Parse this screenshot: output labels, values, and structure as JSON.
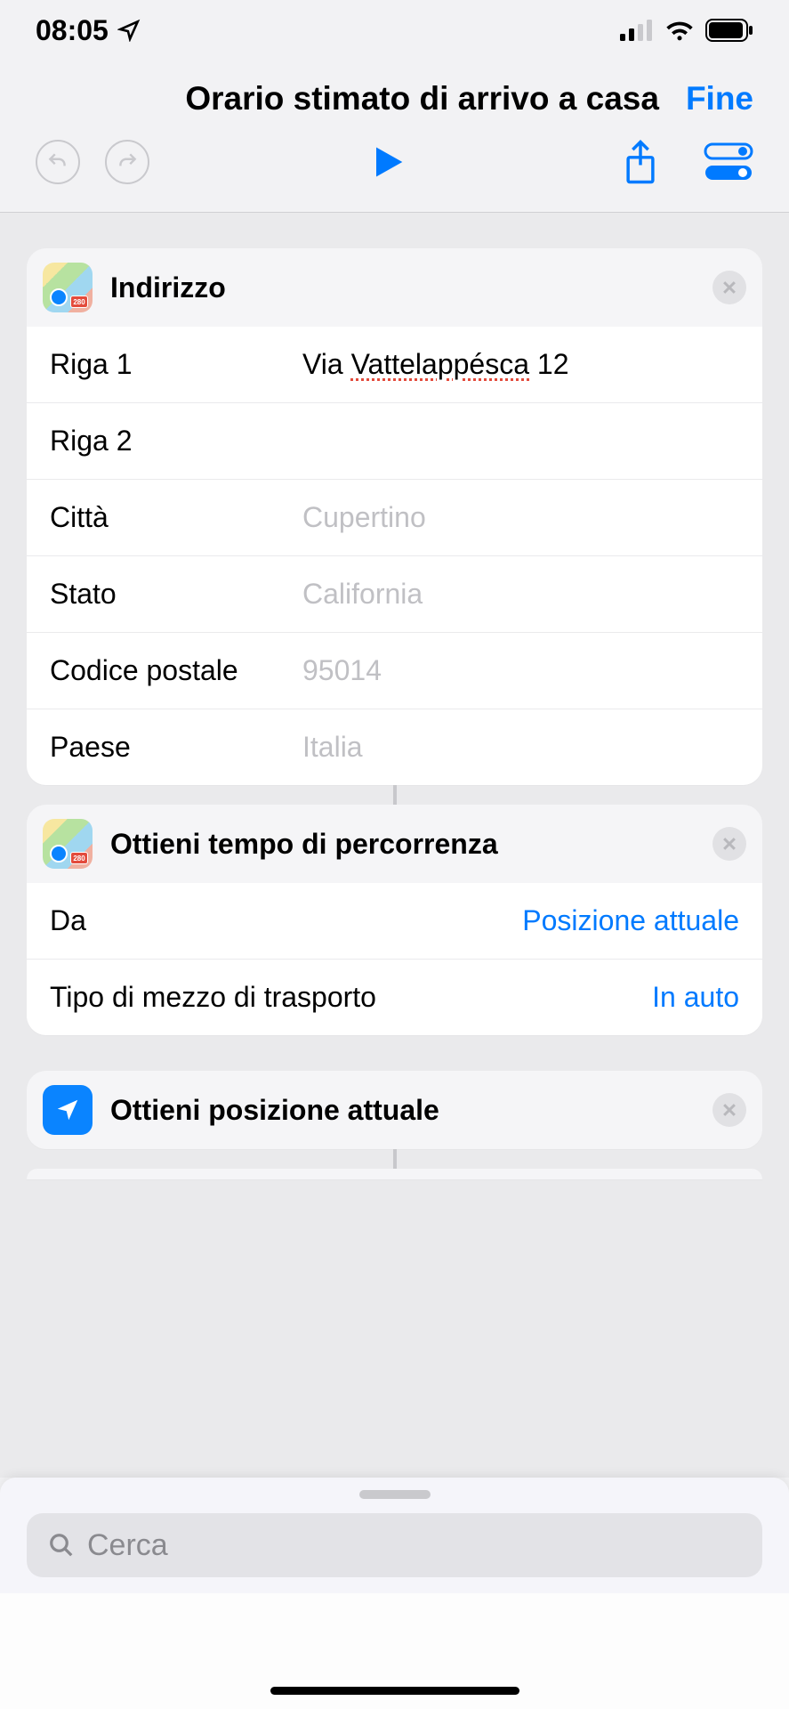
{
  "status": {
    "time": "08:05"
  },
  "header": {
    "title": "Orario stimato di arrivo a casa",
    "done": "Fine"
  },
  "card_address": {
    "title": "Indirizzo",
    "rows": {
      "riga1": {
        "label": "Riga 1",
        "value": "Via Vattelappésca 12"
      },
      "riga2": {
        "label": "Riga 2",
        "value": ""
      },
      "citta": {
        "label": "Città",
        "placeholder": "Cupertino"
      },
      "stato": {
        "label": "Stato",
        "placeholder": "California"
      },
      "cap": {
        "label": "Codice postale",
        "placeholder": "95014"
      },
      "paese": {
        "label": "Paese",
        "placeholder": "Italia"
      }
    }
  },
  "card_travel": {
    "title": "Ottieni tempo di percorrenza",
    "rows": {
      "da": {
        "label": "Da",
        "value": "Posizione attuale"
      },
      "tipo": {
        "label": "Tipo di mezzo di trasporto",
        "value": "In auto"
      }
    }
  },
  "card_location": {
    "title": "Ottieni posizione attuale"
  },
  "search": {
    "placeholder": "Cerca"
  },
  "maps_icon_badge": "280"
}
